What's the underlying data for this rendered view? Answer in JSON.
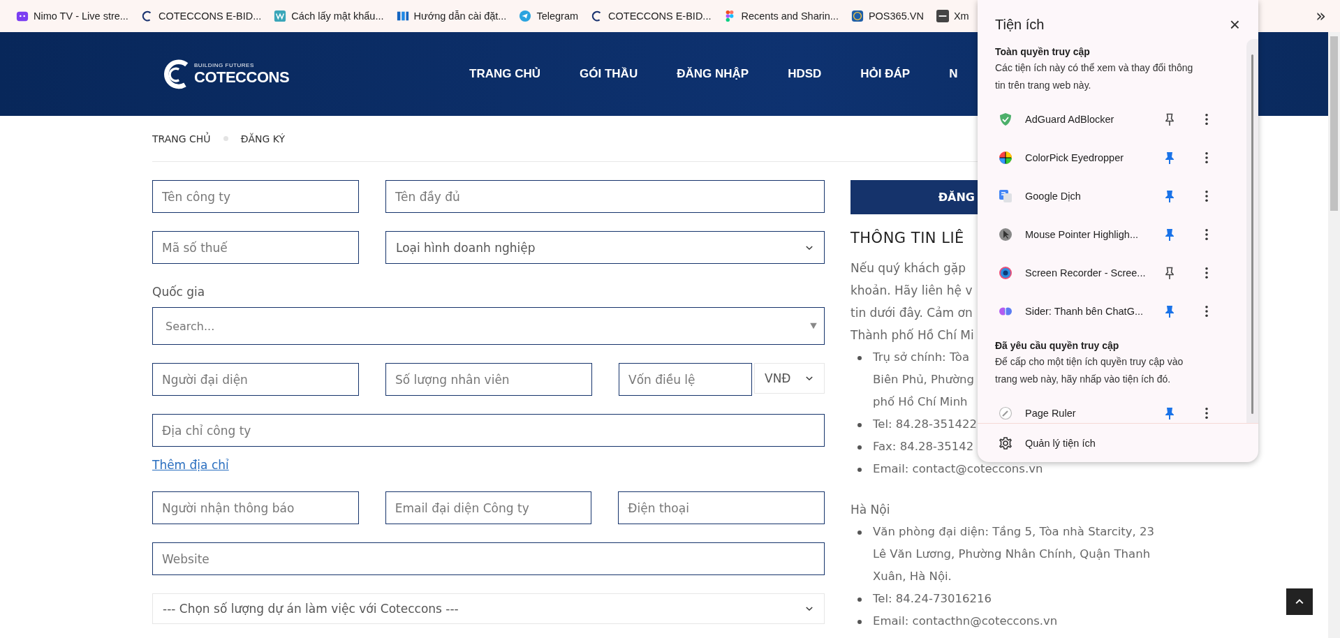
{
  "bookmarks": [
    {
      "label": "Nimo TV - Live stre..."
    },
    {
      "label": "COTECCONS E-BID..."
    },
    {
      "label": "Cách lấy mật khẩu..."
    },
    {
      "label": "Hướng dẫn cài đặt..."
    },
    {
      "label": "Telegram"
    },
    {
      "label": "COTECCONS E-BID..."
    },
    {
      "label": "Recents and Sharin..."
    },
    {
      "label": "POS365.VN"
    },
    {
      "label": "Xm"
    }
  ],
  "bookmarks_overflow": "»",
  "header": {
    "logo_tagline": "BUILDING FUTURES",
    "logo_text": "COTECCONS",
    "nav": [
      {
        "label": "TRANG CHỦ"
      },
      {
        "label": "GÓI THẦU"
      },
      {
        "label": "ĐĂNG NHẬP"
      },
      {
        "label": "HDSD"
      },
      {
        "label": "HỎI ĐÁP"
      },
      {
        "label": "N"
      }
    ]
  },
  "breadcrumb": [
    "TRANG CHỦ",
    "ĐĂNG KÝ"
  ],
  "form": {
    "rows": [
      [
        {
          "kind": "input",
          "placeholder": "Tên công ty"
        },
        {
          "kind": "input",
          "placeholder": "Tên đầy đủ"
        }
      ],
      [
        {
          "kind": "input",
          "placeholder": "Mã số thuế"
        },
        {
          "kind": "select",
          "value": "Loại hình doanh nghiệp"
        }
      ],
      [
        {
          "kind": "label",
          "text": "Quốc gia"
        }
      ],
      [
        {
          "kind": "search",
          "placeholder": "Search..."
        }
      ],
      [
        {
          "kind": "input",
          "placeholder": "Người đại diện"
        },
        {
          "kind": "input",
          "placeholder": "Số lượng nhân viên"
        },
        {
          "kind": "input",
          "placeholder": "Vốn điều lệ"
        },
        {
          "kind": "select",
          "value": "VNĐ"
        }
      ],
      [
        {
          "kind": "input",
          "placeholder": "Địa chỉ công ty"
        }
      ],
      [
        {
          "kind": "link",
          "text": "Thêm địa chỉ"
        }
      ],
      [
        {
          "kind": "input",
          "placeholder": "Người nhận thông báo"
        },
        {
          "kind": "input",
          "placeholder": "Email đại diện Công ty"
        },
        {
          "kind": "input",
          "placeholder": "Điện thoại"
        }
      ],
      [
        {
          "kind": "input",
          "placeholder": "Website"
        }
      ],
      [
        {
          "kind": "select",
          "value": "--- Chọn số lượng dự án làm việc với Coteccons ---"
        }
      ]
    ]
  },
  "contact": {
    "button": "ĐĂNG",
    "heading": "THÔNG TIN LIÊ",
    "intro_lines": [
      "Nếu quý khách gặp",
      "khoản. Hãy liên hệ v",
      "tin dưới đây. Cảm ơn",
      "Thành phố Hồ Chí Mi"
    ],
    "hcm_items": [
      [
        "Trụ sở chính: Tòa",
        "Biên Phủ, Phường",
        "phố Hồ Chí Minh"
      ],
      [
        "Tel: 84.28-351422"
      ],
      [
        "Fax: 84.28-35142"
      ],
      [
        "Email: contact@coteccons.vn"
      ]
    ],
    "hn_title": "Hà Nội",
    "hn_items": [
      [
        "Văn phòng đại diện: Tầng 5, Tòa nhà Starcity, 23",
        "Lê Văn Lương, Phường Nhân Chính, Quận Thanh",
        "Xuân, Hà Nội."
      ],
      [
        "Tel: 84.24-73016216"
      ],
      [
        "Email: contacthn@coteccons.vn"
      ]
    ]
  },
  "extensions_popup": {
    "title": "Tiện ích",
    "close": "×",
    "full_access": {
      "heading": "Toàn quyền truy cập",
      "description": "Các tiện ích này có thể xem và thay đổi thông tin trên trang web này.",
      "items": [
        {
          "name": "AdGuard AdBlocker",
          "pinned": false
        },
        {
          "name": "ColorPick Eyedropper",
          "pinned": true
        },
        {
          "name": "Google Dịch",
          "pinned": true
        },
        {
          "name": "Mouse Pointer Highligh...",
          "pinned": true
        },
        {
          "name": "Screen Recorder - Scree...",
          "pinned": false
        },
        {
          "name": "Sider: Thanh bên ChatG...",
          "pinned": true
        }
      ]
    },
    "requested_access": {
      "heading": "Đã yêu cầu quyền truy cập",
      "description": "Để cấp cho một tiện ích quyền truy cập vào trang web này, hãy nhấp vào tiện ích đó.",
      "items": [
        {
          "name": "Page Ruler",
          "pinned": true
        }
      ]
    },
    "manage": "Quản lý tiện ích"
  }
}
